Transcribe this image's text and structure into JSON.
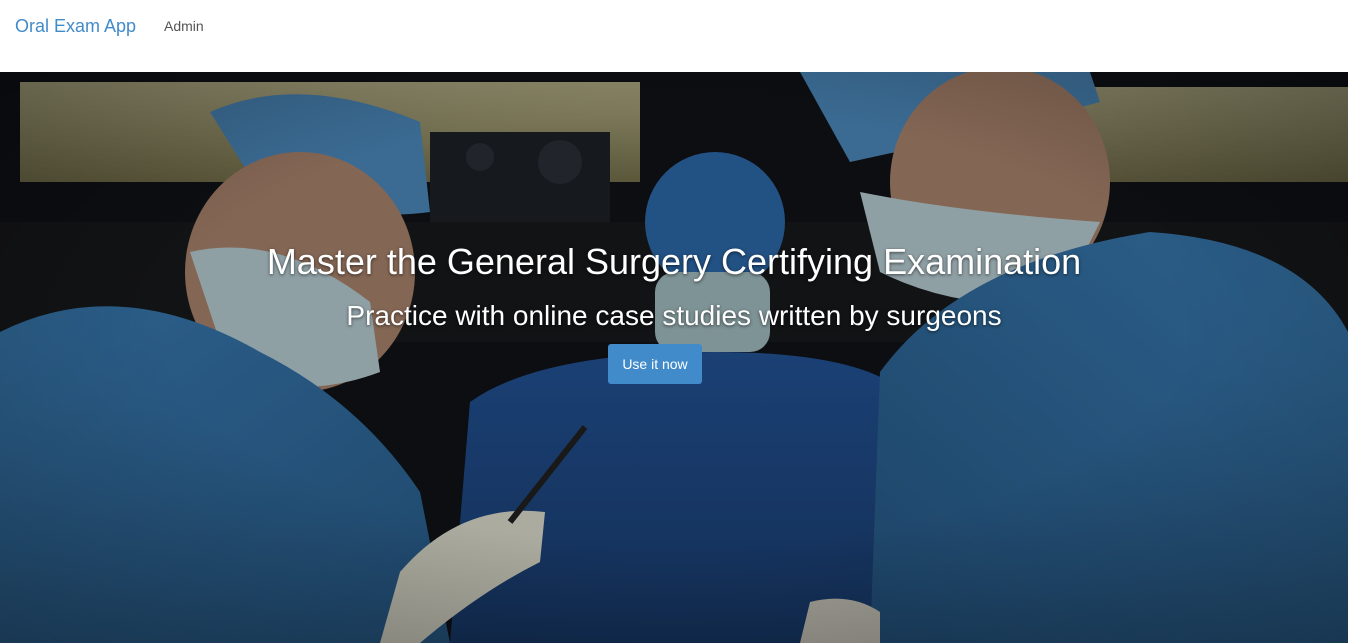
{
  "navbar": {
    "brand": "Oral Exam App",
    "links": [
      {
        "label": "Admin"
      }
    ]
  },
  "hero": {
    "title": "Master the General Surgery Certifying Examination",
    "subtitle": "Practice with online case studies written by surgeons",
    "cta_label": "Use it now",
    "image_description": "surgeons-operating-photo"
  },
  "colors": {
    "brand": "#428bca",
    "button": "#428bca",
    "nav_link": "#555555",
    "scrub_blue": "#3f7fb3"
  }
}
